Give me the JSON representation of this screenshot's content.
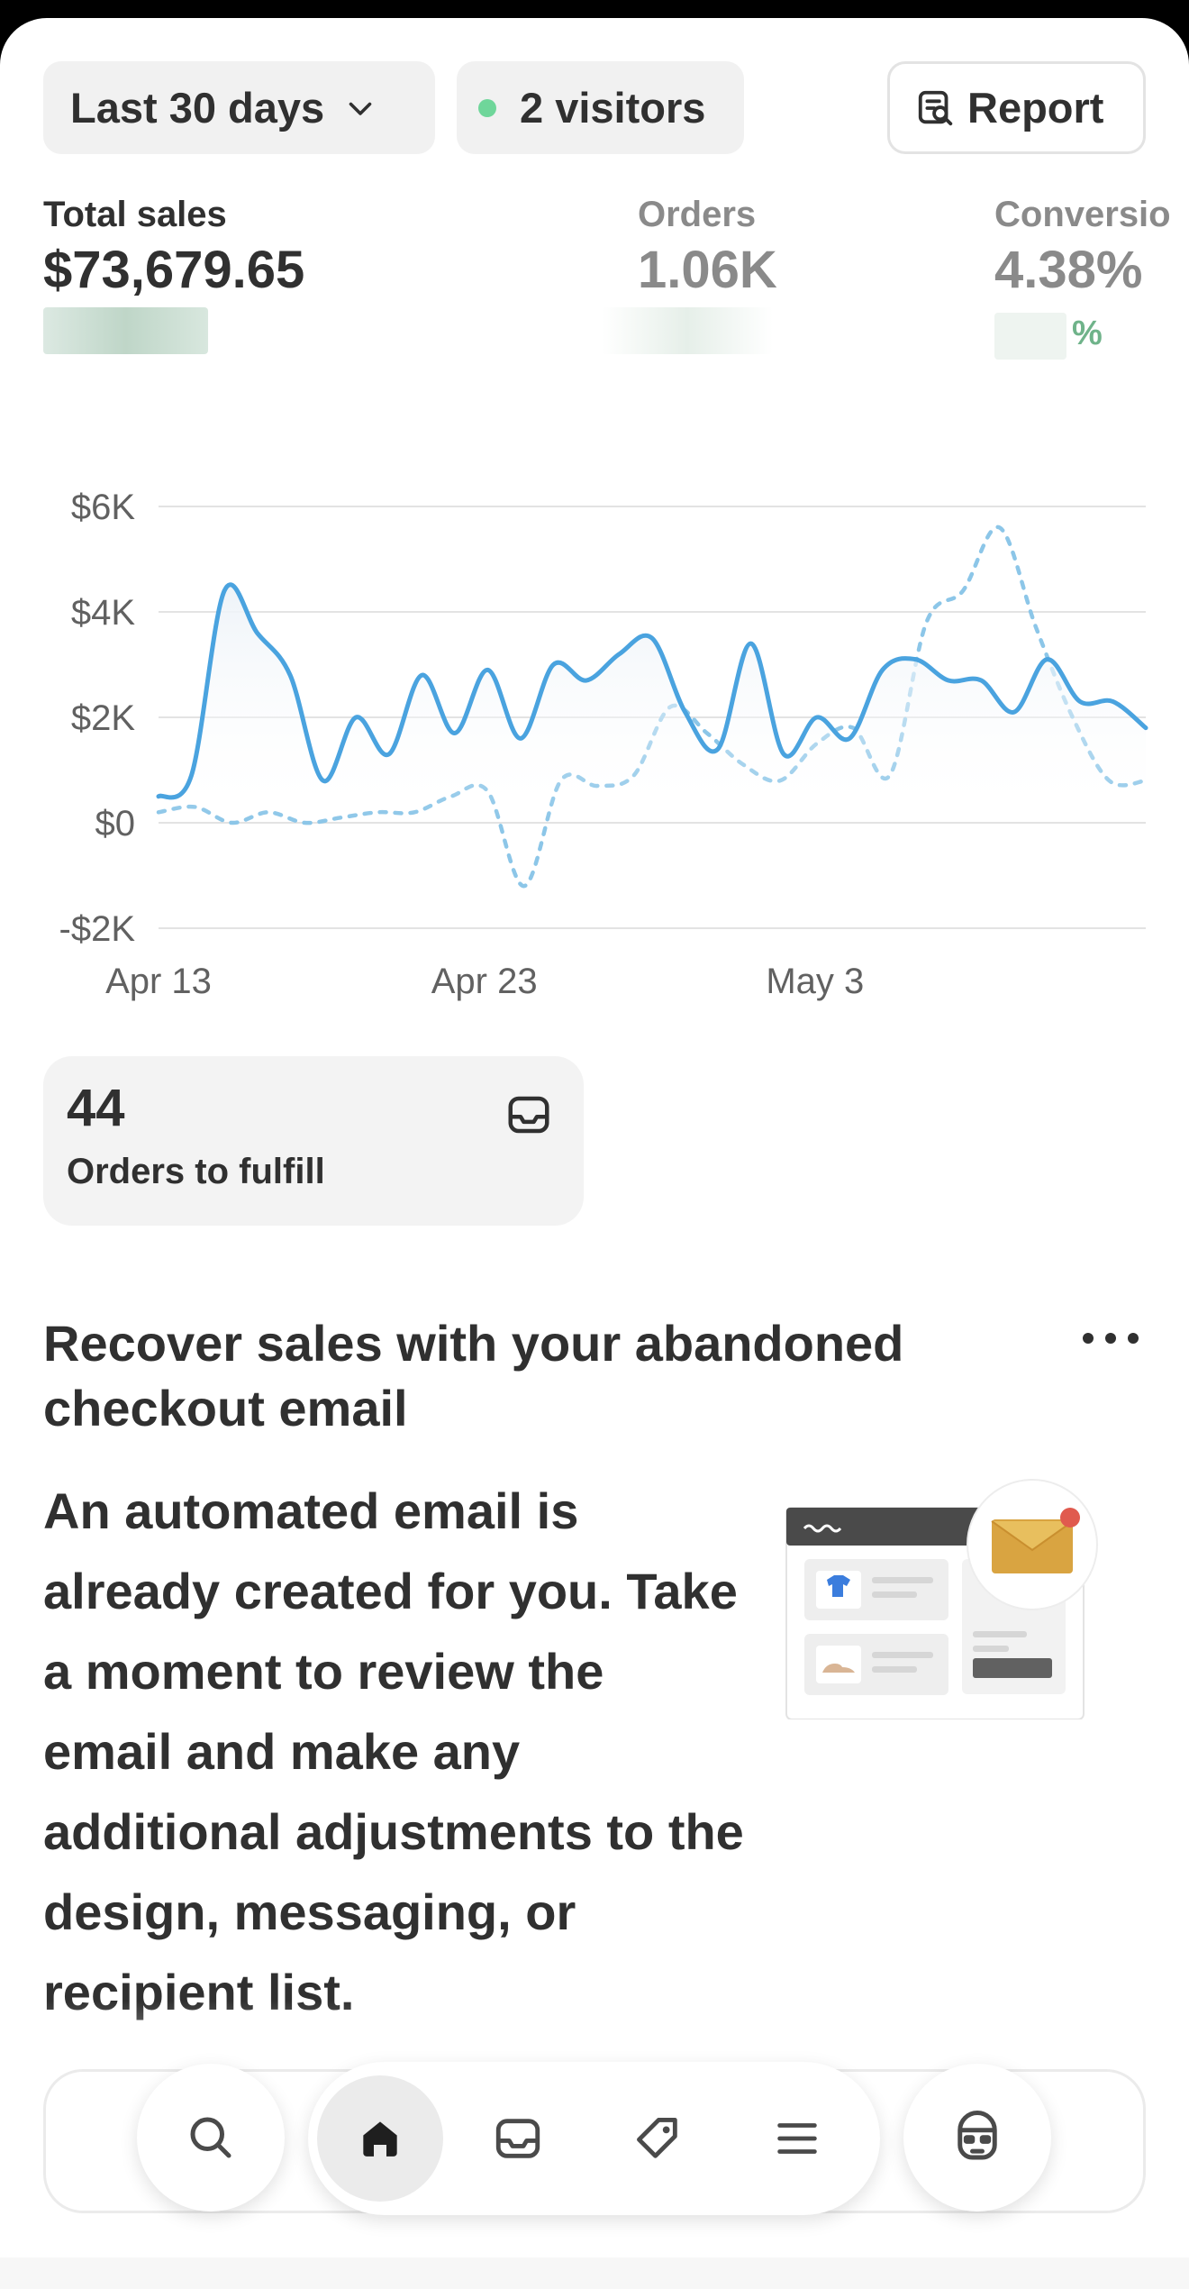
{
  "filters": {
    "date_range": "Last 30 days",
    "visitors": "2 visitors",
    "report_label": "Report"
  },
  "metrics": [
    {
      "label": "Total sales",
      "value": "$73,679.65"
    },
    {
      "label": "Orders",
      "value": "1.06K"
    },
    {
      "label": "Conversio",
      "value": "4.38%",
      "change_suffix": "%"
    }
  ],
  "chart_data": {
    "type": "line",
    "y_ticks": [
      "$6K",
      "$4K",
      "$2K",
      "$0",
      "-$2K"
    ],
    "x_ticks": [
      "Apr 13",
      "Apr 23",
      "May 3"
    ],
    "ylim": [
      -2000,
      6000
    ],
    "grid": true,
    "series": [
      {
        "style": "solid",
        "color": "#4aa3df",
        "values": [
          500,
          900,
          4400,
          3600,
          2800,
          800,
          2000,
          1300,
          2800,
          1700,
          2900,
          1600,
          3000,
          2700,
          3200,
          3500,
          2100,
          1400,
          3400,
          1300,
          2000,
          1600,
          2900,
          3100,
          2700,
          2700,
          2100,
          3100,
          2300,
          2300,
          1800
        ]
      },
      {
        "style": "dotted",
        "color": "#8cc6e8",
        "values": [
          200,
          300,
          0,
          200,
          0,
          100,
          200,
          200,
          500,
          600,
          -1200,
          800,
          700,
          900,
          2200,
          1700,
          1100,
          800,
          1500,
          1800,
          900,
          3800,
          4400,
          5600,
          3700,
          2000,
          800,
          800
        ]
      }
    ]
  },
  "fulfill_card": {
    "count": "44",
    "label": "Orders to fulfill"
  },
  "promo": {
    "title": "Recover sales with your abandoned checkout email",
    "body": "An automated email is already created for you. Take a moment to review the email and make any additional adjustments to the design, messaging, or recipient list."
  },
  "nav": {
    "items": [
      "search-icon",
      "home-icon",
      "inbox-icon",
      "tag-icon",
      "menu-icon",
      "sidekick-icon"
    ],
    "active": "home-icon"
  },
  "colors": {
    "accent": "#4aa3df",
    "accent_light": "#8cc6e8",
    "live_dot": "#6fd69a"
  }
}
